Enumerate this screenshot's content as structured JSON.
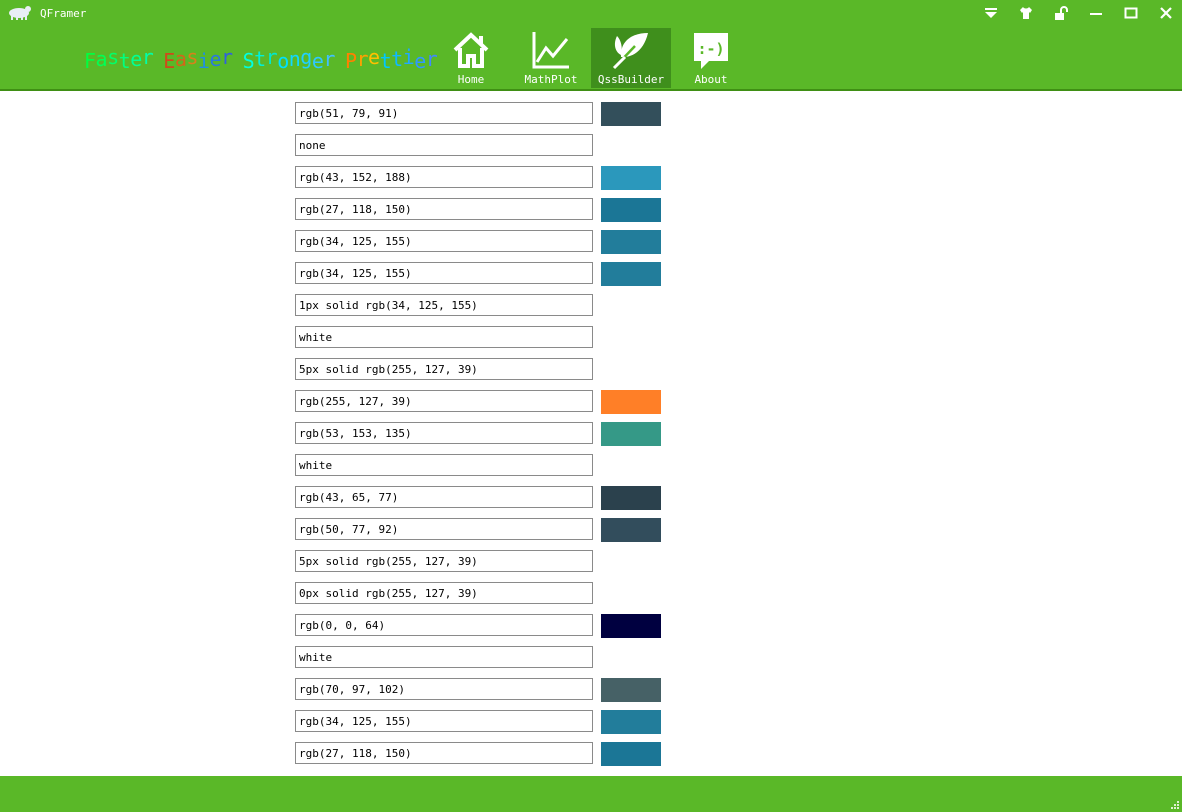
{
  "window": {
    "title": "QFramer"
  },
  "slogan": [
    [
      {
        "t": "F",
        "c": "#00ff40"
      },
      {
        "t": "a",
        "c": "#00ff55"
      },
      {
        "t": "s",
        "c": "#00ff6a"
      },
      {
        "t": "t",
        "c": "#00ff80"
      },
      {
        "t": "e",
        "c": "#00ff95"
      },
      {
        "t": "r",
        "c": "#00ffaa"
      }
    ],
    [
      {
        "t": "E",
        "c": "#d04a1a"
      },
      {
        "t": "a",
        "c": "#d4651a"
      },
      {
        "t": "s",
        "c": "#d9801a"
      },
      {
        "t": "i",
        "c": "#2090e0"
      },
      {
        "t": "e",
        "c": "#2a78e0"
      },
      {
        "t": "r",
        "c": "#3060e0"
      }
    ],
    [
      {
        "t": "S",
        "c": "#00ffe0"
      },
      {
        "t": "t",
        "c": "#00f0d8"
      },
      {
        "t": "r",
        "c": "#00e8d0"
      },
      {
        "t": "o",
        "c": "#00e0ff"
      },
      {
        "t": "n",
        "c": "#10d8ff"
      },
      {
        "t": "g",
        "c": "#20d0ff"
      },
      {
        "t": "e",
        "c": "#30c8ff"
      },
      {
        "t": "r",
        "c": "#40c0ff"
      }
    ],
    [
      {
        "t": "P",
        "c": "#ff8000"
      },
      {
        "t": "r",
        "c": "#ffa000"
      },
      {
        "t": "e",
        "c": "#ffc000"
      },
      {
        "t": "t",
        "c": "#00c8ff"
      },
      {
        "t": "t",
        "c": "#10b8ff"
      },
      {
        "t": "i",
        "c": "#20a8ff"
      },
      {
        "t": "e",
        "c": "#3098ff"
      },
      {
        "t": "r",
        "c": "#4088ff"
      }
    ]
  ],
  "nav": [
    {
      "label": "Home",
      "icon": "home-icon",
      "active": false
    },
    {
      "label": "MathPlot",
      "icon": "chart-line-icon",
      "active": false
    },
    {
      "label": "QssBuilder",
      "icon": "leaf-icon",
      "active": true
    },
    {
      "label": "About",
      "icon": "smiley-chat-icon",
      "active": false
    }
  ],
  "window_controls": [
    {
      "name": "dropdown-menu-icon"
    },
    {
      "name": "skin-shirt-icon"
    },
    {
      "name": "lock-icon"
    },
    {
      "name": "minimize-icon"
    },
    {
      "name": "maximize-icon"
    },
    {
      "name": "close-icon"
    }
  ],
  "rows": [
    {
      "value": "rgb(51, 79, 91)",
      "swatch": "#334f5b"
    },
    {
      "value": "none",
      "swatch": null
    },
    {
      "value": "rgb(43, 152, 188)",
      "swatch": "#2b98bc"
    },
    {
      "value": "rgb(27, 118, 150)",
      "swatch": "#1b7696"
    },
    {
      "value": "rgb(34, 125, 155)",
      "swatch": "#227d9b"
    },
    {
      "value": "rgb(34, 125, 155)",
      "swatch": "#227d9b"
    },
    {
      "value": "1px solid rgb(34, 125, 155)",
      "swatch": null
    },
    {
      "value": "white",
      "swatch": null
    },
    {
      "value": "5px solid rgb(255, 127, 39)",
      "swatch": null
    },
    {
      "value": "rgb(255, 127, 39)",
      "swatch": "#ff7f27"
    },
    {
      "value": "rgb(53, 153, 135)",
      "swatch": "#359987"
    },
    {
      "value": "white",
      "swatch": null
    },
    {
      "value": "rgb(43, 65, 77)",
      "swatch": "#2b414d"
    },
    {
      "value": "rgb(50, 77, 92)",
      "swatch": "#324d5c"
    },
    {
      "value": "5px solid rgb(255, 127, 39)",
      "swatch": null
    },
    {
      "value": "0px solid rgb(255, 127, 39)",
      "swatch": null
    },
    {
      "value": "rgb(0, 0, 64)",
      "swatch": "#000040"
    },
    {
      "value": "white",
      "swatch": null
    },
    {
      "value": "rgb(70, 97, 102)",
      "swatch": "#466166"
    },
    {
      "value": "rgb(34, 125, 155)",
      "swatch": "#227d9b"
    },
    {
      "value": "rgb(27, 118, 150)",
      "swatch": "#1b7696"
    }
  ],
  "theme": {
    "header": "#5ab828",
    "active_nav": "#3f8f1c"
  }
}
